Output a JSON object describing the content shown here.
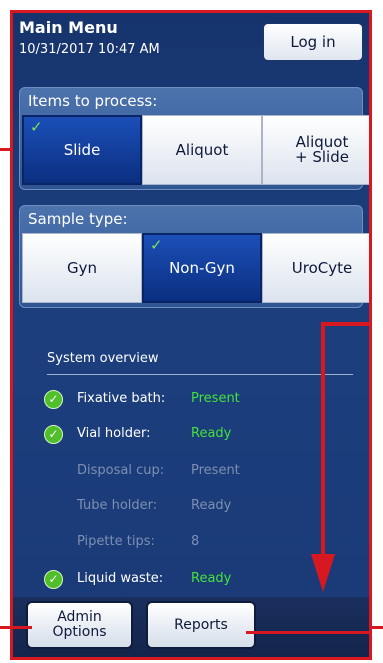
{
  "header": {
    "title": "Main Menu",
    "datetime": "10/31/2017 10:47 AM",
    "login_label": "Log in"
  },
  "items_to_process": {
    "title": "Items to process:",
    "options": [
      {
        "label": "Slide",
        "selected": true
      },
      {
        "label": "Aliquot",
        "selected": false
      },
      {
        "label": "Aliquot\n+ Slide",
        "selected": false
      }
    ]
  },
  "sample_type": {
    "title": "Sample type:",
    "options": [
      {
        "label": "Gyn",
        "selected": false
      },
      {
        "label": "Non-Gyn",
        "selected": true
      },
      {
        "label": "UroCyte",
        "selected": false
      }
    ]
  },
  "overview": {
    "title": "System overview",
    "rows": [
      {
        "label": "Fixative bath:",
        "value": "Present",
        "state": "ok"
      },
      {
        "label": "Vial holder:",
        "value": "Ready",
        "state": "ok"
      },
      {
        "label": "Disposal cup:",
        "value": "Present",
        "state": "dim"
      },
      {
        "label": "Tube holder:",
        "value": "Ready",
        "state": "dim"
      },
      {
        "label": "Pipette tips:",
        "value": "8",
        "state": "dim"
      },
      {
        "label": "Liquid waste:",
        "value": "Ready",
        "state": "ok"
      }
    ]
  },
  "footer": {
    "admin_label": "Admin\nOptions",
    "reports_label": "Reports"
  },
  "colors": {
    "annotation": "#d81820",
    "ok_text": "#44e23c",
    "selected_button": "#1b4fb8"
  }
}
